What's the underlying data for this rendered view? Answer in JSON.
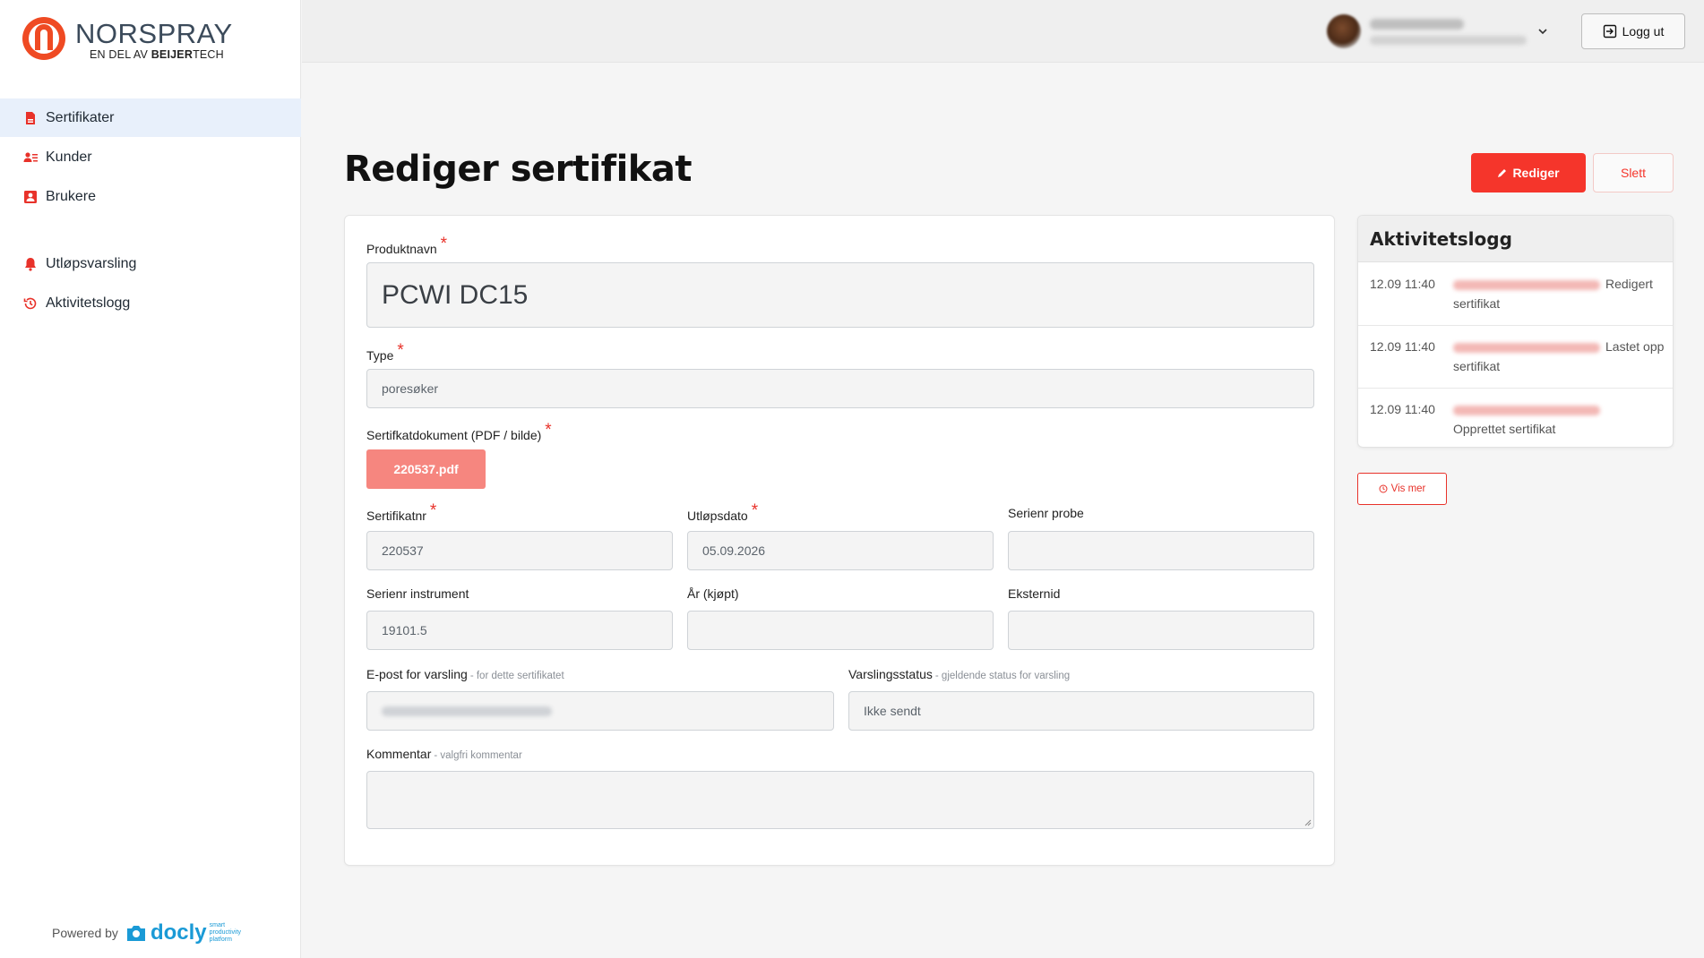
{
  "brand": {
    "title": "NORSPRAY",
    "subtitle_prefix": "EN DEL AV ",
    "subtitle_brand": "BEIJER",
    "subtitle_suffix": "TECH",
    "accent": "#f5352b",
    "logo_color": "#ef4a23"
  },
  "sidebar": {
    "items": [
      {
        "label": "Sertifikater",
        "icon": "document-icon",
        "active": true
      },
      {
        "label": "Kunder",
        "icon": "users-icon",
        "active": false
      },
      {
        "label": "Brukere",
        "icon": "contact-card-icon",
        "active": false
      },
      {
        "label": "Utløpsvarsling",
        "icon": "bell-icon",
        "active": false
      },
      {
        "label": "Aktivitetslogg",
        "icon": "history-icon",
        "active": false
      }
    ],
    "powered_by": "Powered by",
    "powered_brand": "docly",
    "powered_tag": "smart productivity platform"
  },
  "header": {
    "logout_label": "Logg ut"
  },
  "page": {
    "title": "Rediger sertifikat",
    "edit_label": "Rediger",
    "delete_label": "Slett"
  },
  "form": {
    "product": {
      "label": "Produktnavn",
      "value": "PCWI DC15"
    },
    "type": {
      "label": "Type",
      "value": "poresøker"
    },
    "document": {
      "label": "Sertifkatdokument (PDF / bilde)",
      "file": "220537.pdf"
    },
    "cert_no": {
      "label": "Sertifikatnr",
      "value": "220537"
    },
    "expiry": {
      "label": "Utløpsdato",
      "value": "05.09.2026"
    },
    "probe_serial": {
      "label": "Serienr probe",
      "value": ""
    },
    "instrument_serial": {
      "label": "Serienr instrument",
      "value": "19101.5"
    },
    "year_bought": {
      "label": "År (kjøpt)",
      "value": ""
    },
    "external_id": {
      "label": "Eksternid",
      "value": ""
    },
    "email": {
      "label": "E-post for varsling",
      "hint": "- for dette sertifikatet"
    },
    "status": {
      "label": "Varslingsstatus",
      "hint": "- gjeldende status for varsling",
      "value": "Ikke sendt"
    },
    "comment": {
      "label": "Kommentar",
      "hint": "- valgfri kommentar",
      "value": ""
    }
  },
  "activity": {
    "title": "Aktivitetslogg",
    "entries": [
      {
        "time": "12.09 11:40",
        "desc": "Redigert sertifikat"
      },
      {
        "time": "12.09 11:40",
        "desc": "Lastet opp sertifikat"
      },
      {
        "time": "12.09 11:40",
        "desc": "Opprettet sertifikat"
      }
    ],
    "more_label": "Vis mer"
  }
}
